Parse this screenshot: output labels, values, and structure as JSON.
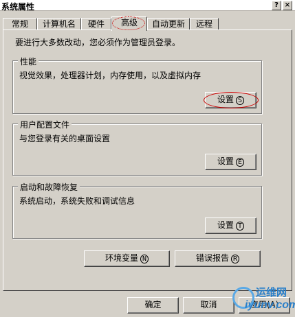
{
  "window": {
    "title": "系统属性",
    "help_label": "?",
    "close_label": "×"
  },
  "tabs": [
    {
      "label": "常规"
    },
    {
      "label": "计算机名"
    },
    {
      "label": "硬件"
    },
    {
      "label": "高级",
      "active": true
    },
    {
      "label": "自动更新"
    },
    {
      "label": "远程"
    }
  ],
  "intro": "要进行大多数改动，您必须作为管理员登录。",
  "groups": {
    "performance": {
      "title": "性能",
      "desc": "视觉效果，处理器计划，内存使用，以及虚拟内存",
      "button": "设置",
      "accel": "S"
    },
    "profiles": {
      "title": "用户配置文件",
      "desc": "与您登录有关的桌面设置",
      "button": "设置",
      "accel": "E"
    },
    "startup": {
      "title": "启动和故障恢复",
      "desc": "系统启动，系统失败和调试信息",
      "button": "设置",
      "accel": "T"
    }
  },
  "actions": {
    "env_vars": {
      "label": "环境变量",
      "accel": "N"
    },
    "error_report": {
      "label": "错误报告",
      "accel": "R"
    }
  },
  "footer": {
    "ok": "确定",
    "cancel": "取消",
    "apply": "应用(A)"
  },
  "watermark": {
    "cn": "运维网",
    "en": "iyunv.com"
  }
}
